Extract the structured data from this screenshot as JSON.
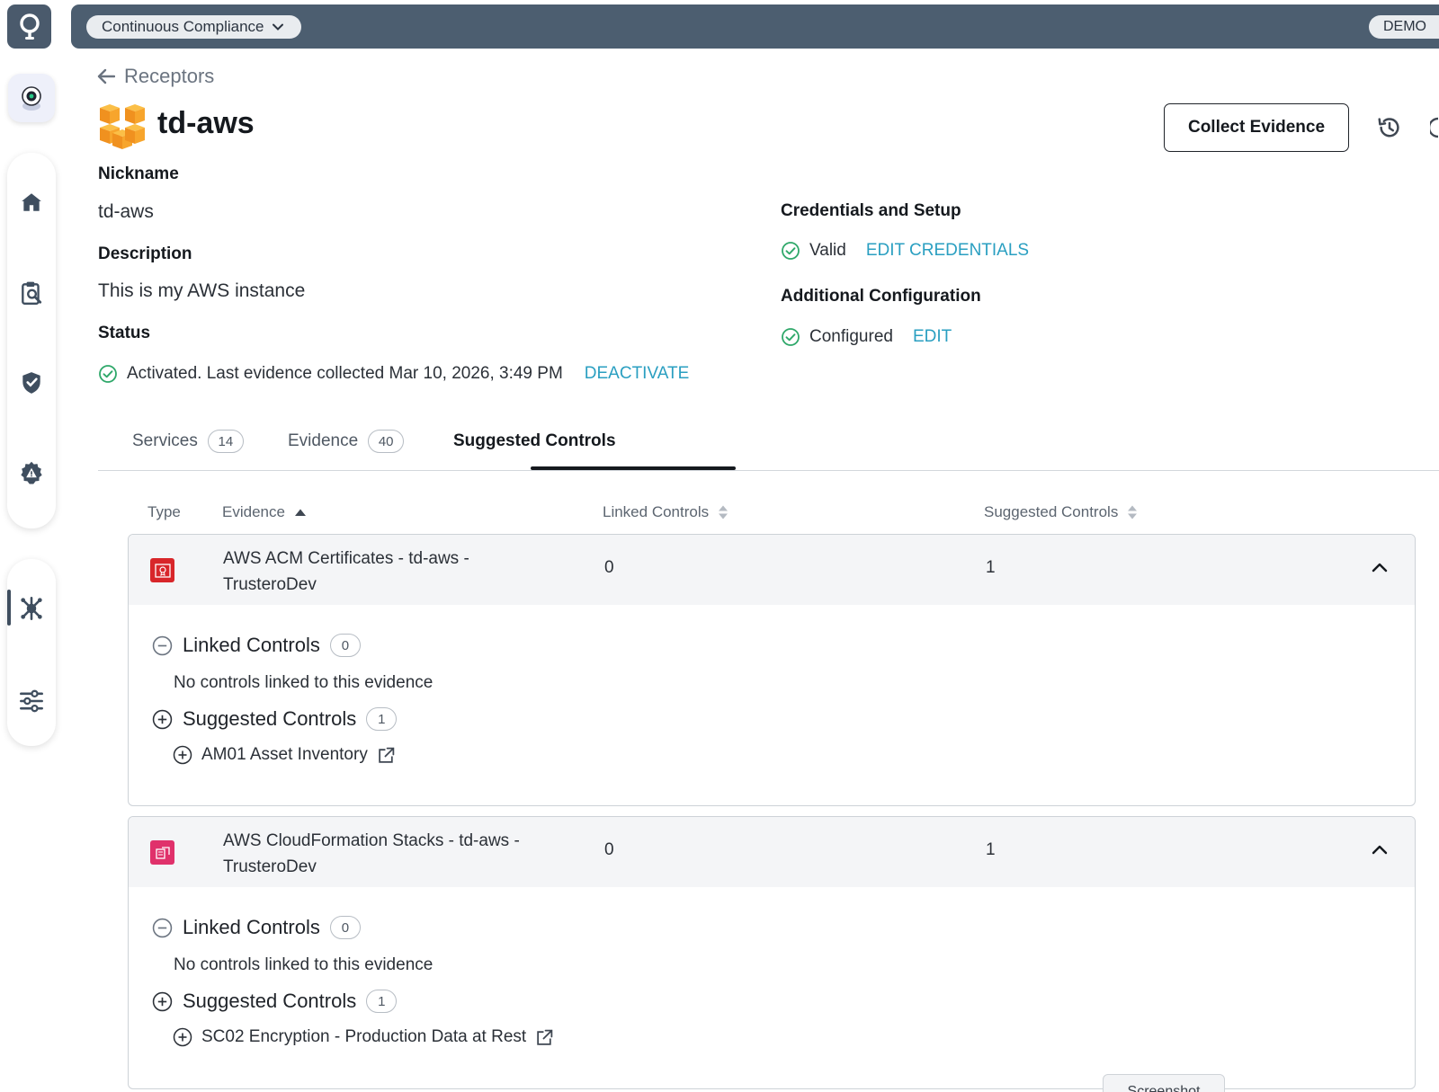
{
  "topbar": {
    "workspace_label": "Continuous Compliance",
    "environment_badge": "DEMO"
  },
  "nav": {
    "icons": [
      "logo-icon",
      "assistant-bot-icon",
      "home-icon",
      "clipboard-search-icon",
      "shield-check-icon",
      "gear-alert-icon",
      "integrations-hub-icon",
      "settings-sliders-icon"
    ],
    "active_item": "integrations-hub-icon"
  },
  "header": {
    "back_label": "Receptors",
    "title": "td-aws",
    "collect_button": "Collect Evidence"
  },
  "details": {
    "nickname_label": "Nickname",
    "nickname_value": "td-aws",
    "description_label": "Description",
    "description_value": "This is my AWS instance",
    "status_label": "Status",
    "status_value": "Activated. Last evidence collected Mar 10, 2026, 3:49 PM",
    "deactivate_label": "DEACTIVATE",
    "credentials_label": "Credentials and Setup",
    "credentials_value": "Valid",
    "edit_credentials_label": "EDIT CREDENTIALS",
    "additional_label": "Additional Configuration",
    "additional_value": "Configured",
    "edit_label": "EDIT"
  },
  "tabs": [
    {
      "label": "Services",
      "count": "14"
    },
    {
      "label": "Evidence",
      "count": "40"
    },
    {
      "label": "Suggested Controls",
      "count": ""
    }
  ],
  "active_tab": "Suggested Controls",
  "table": {
    "columns": [
      "Type",
      "Evidence",
      "Linked Controls",
      "Suggested Controls"
    ],
    "sort_column": "Evidence",
    "sort_direction": "ascending",
    "rows": [
      {
        "evidence": "AWS ACM Certificates - td-aws - TrusteroDev",
        "type_icon": "aws-acm-icon",
        "type_color": "#d8262a",
        "linked_count": "0",
        "suggested_count": "1",
        "expanded": true,
        "linked_section": {
          "title": "Linked Controls",
          "count": "0",
          "empty_text": "No controls linked to this evidence"
        },
        "suggested_section": {
          "title": "Suggested Controls",
          "count": "1",
          "controls": [
            "AM01 Asset Inventory"
          ]
        }
      },
      {
        "evidence": "AWS CloudFormation Stacks - td-aws - TrusteroDev",
        "type_icon": "aws-cloudformation-icon",
        "type_color": "#e0316b",
        "linked_count": "0",
        "suggested_count": "1",
        "expanded": true,
        "linked_section": {
          "title": "Linked Controls",
          "count": "0",
          "empty_text": "No controls linked to this evidence"
        },
        "suggested_section": {
          "title": "Suggested Controls",
          "count": "1",
          "controls": [
            "SC02 Encryption - Production Data at Rest"
          ]
        }
      }
    ]
  },
  "footer": {
    "screenshot_tab": "Screenshot"
  },
  "colors": {
    "topbar": "#4c5e70",
    "link": "#2a9fc1",
    "success": "#2fa86a",
    "tab_active": "#15191e"
  }
}
